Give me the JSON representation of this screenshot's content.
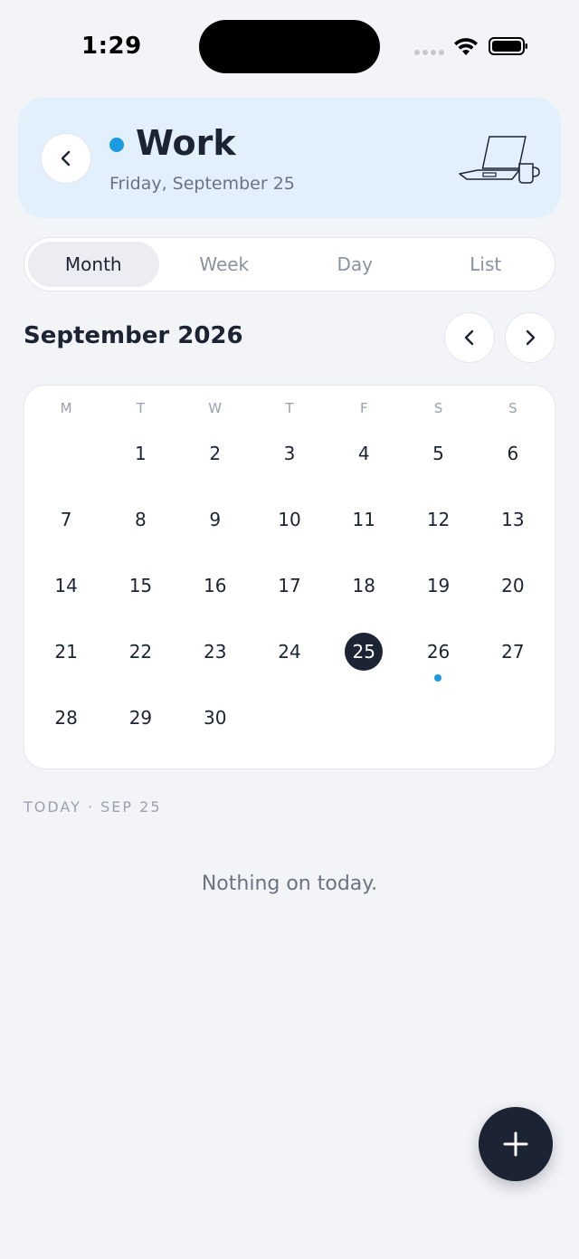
{
  "status_bar": {
    "time": "1:29"
  },
  "header": {
    "calendar_name": "Work",
    "date_label": "Friday, September 25",
    "accent_color": "#1a9be0",
    "illustration": "laptop-and-mug"
  },
  "view_tabs": [
    {
      "label": "Month",
      "active": true
    },
    {
      "label": "Week",
      "active": false
    },
    {
      "label": "Day",
      "active": false
    },
    {
      "label": "List",
      "active": false
    }
  ],
  "month_header": {
    "title": "September 2026"
  },
  "calendar": {
    "weekdays": [
      "M",
      "T",
      "W",
      "T",
      "F",
      "S",
      "S"
    ],
    "weeks": [
      [
        "",
        "1",
        "2",
        "3",
        "4",
        "5",
        "6"
      ],
      [
        "7",
        "8",
        "9",
        "10",
        "11",
        "12",
        "13"
      ],
      [
        "14",
        "15",
        "16",
        "17",
        "18",
        "19",
        "20"
      ],
      [
        "21",
        "22",
        "23",
        "24",
        "25",
        "26",
        "27"
      ],
      [
        "28",
        "29",
        "30",
        "",
        "",
        "",
        ""
      ]
    ],
    "selected_day": "25",
    "days_with_events": [
      "26"
    ]
  },
  "agenda": {
    "section_label": "TODAY · SEP 25",
    "empty_message": "Nothing on today."
  },
  "fab": {
    "icon": "plus-icon"
  }
}
